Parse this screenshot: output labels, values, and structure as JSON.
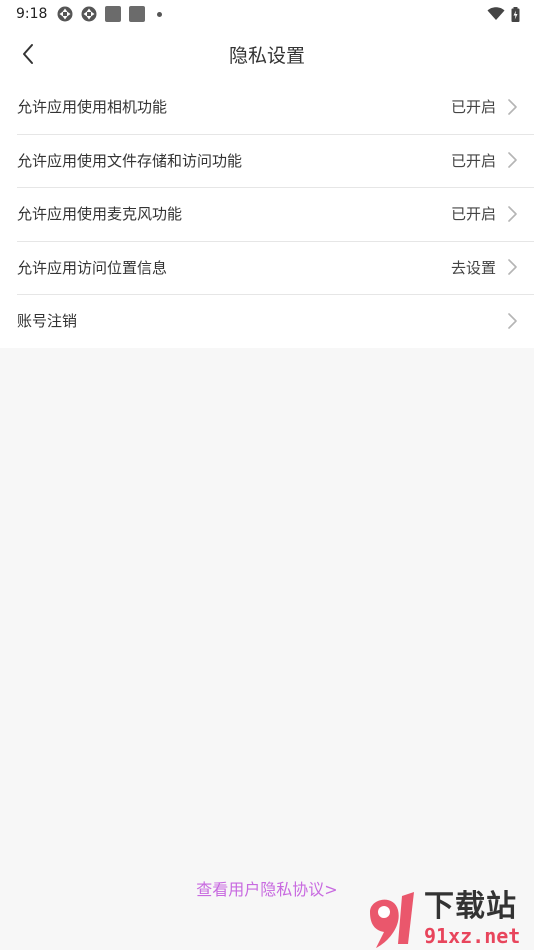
{
  "status_bar": {
    "time": "9:18"
  },
  "header": {
    "title": "隐私设置"
  },
  "settings": [
    {
      "label": "允许应用使用相机功能",
      "status": "已开启"
    },
    {
      "label": "允许应用使用文件存储和访问功能",
      "status": "已开启"
    },
    {
      "label": "允许应用使用麦克风功能",
      "status": "已开启"
    },
    {
      "label": "允许应用访问位置信息",
      "status": "去设置"
    },
    {
      "label": "账号注销",
      "status": ""
    }
  ],
  "footer": {
    "privacy_link": "查看用户隐私协议>"
  },
  "watermark": {
    "cn": "下载站",
    "en": "91xz.net"
  },
  "colors": {
    "accent": "#c86ae0",
    "background": "#f7f7f7",
    "watermark_red": "#e8455c"
  }
}
